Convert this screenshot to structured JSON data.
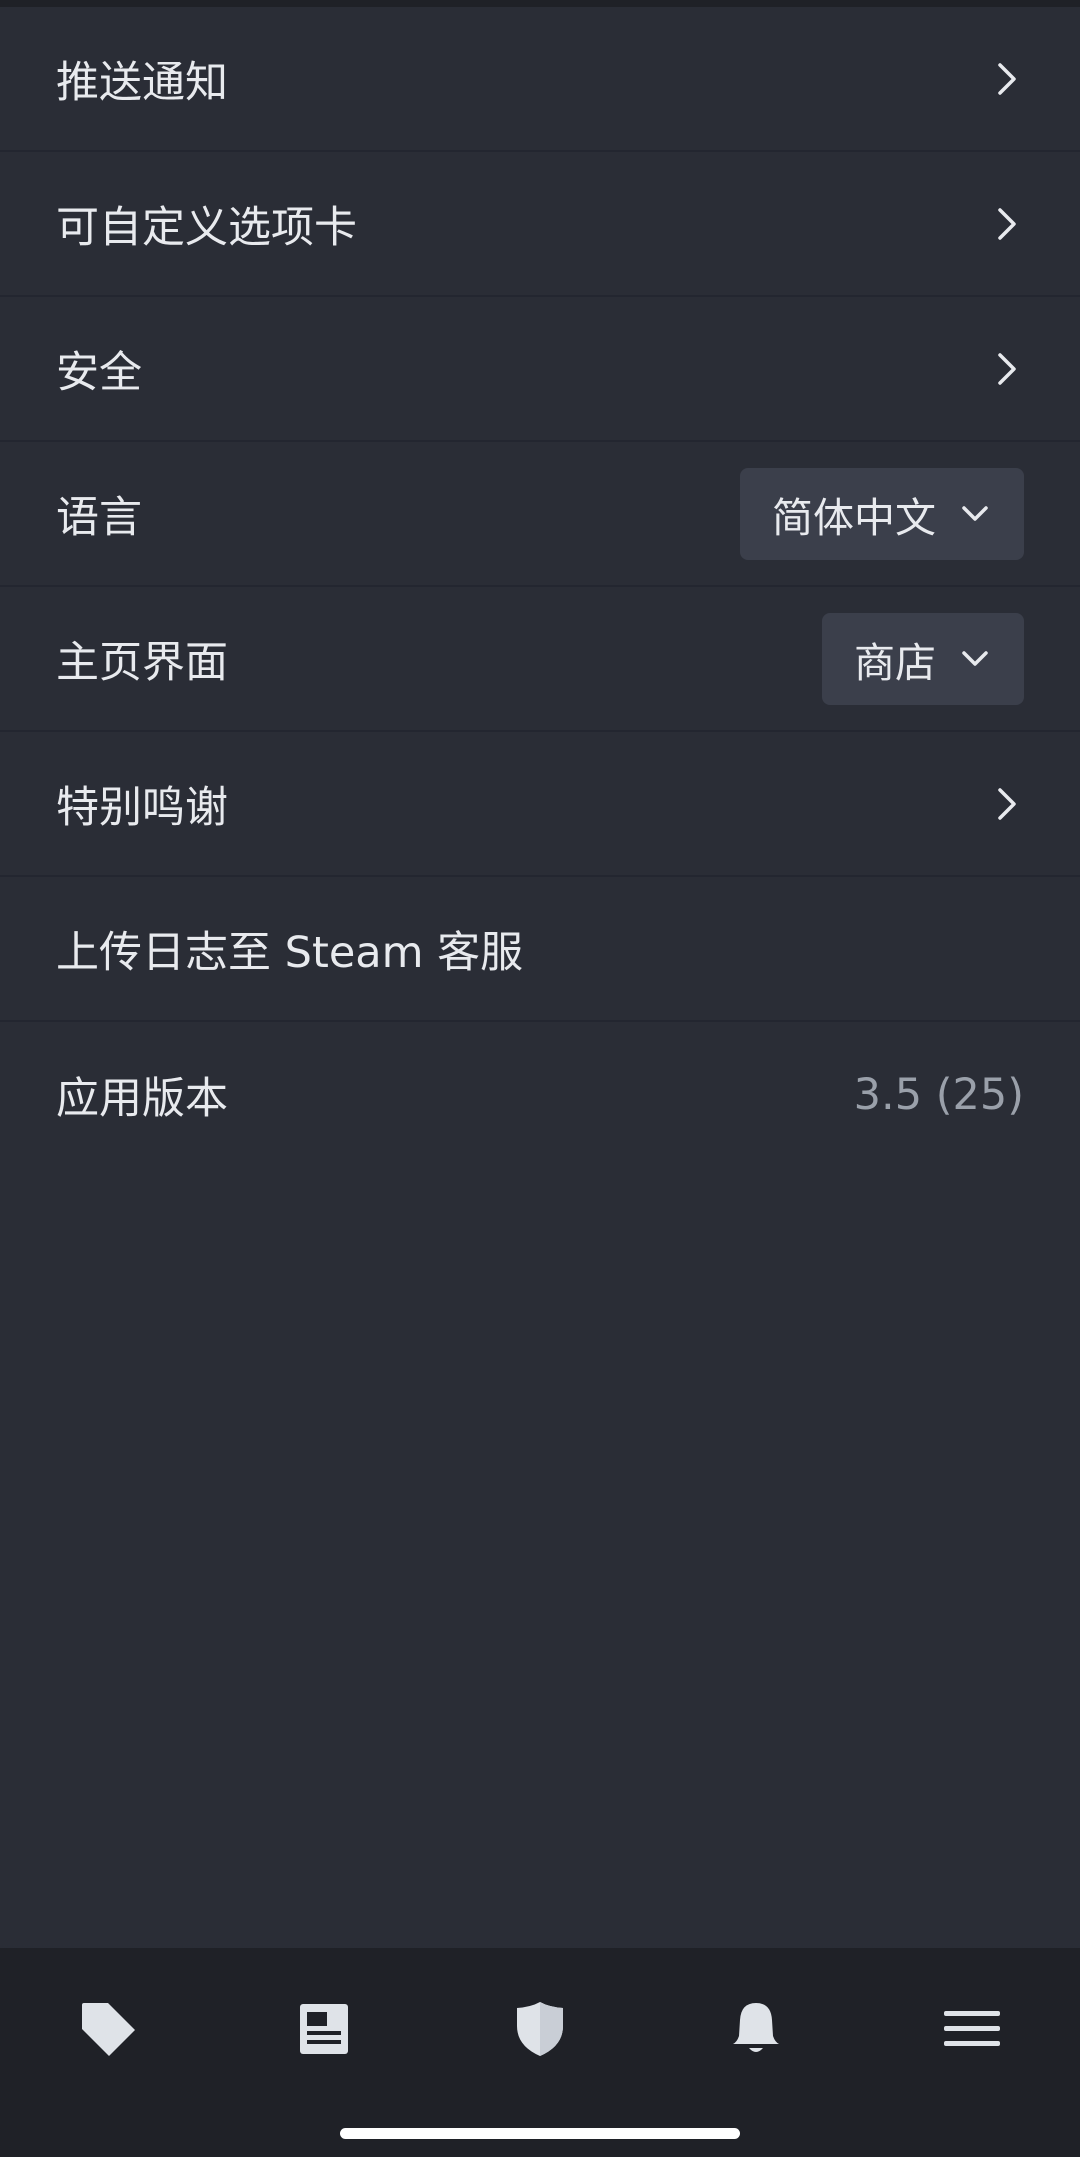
{
  "settings": {
    "push_notifications": "推送通知",
    "custom_tabs": "可自定义选项卡",
    "security": "安全",
    "language_label": "语言",
    "language_value": "简体中文",
    "home_label": "主页界面",
    "home_value": "商店",
    "special_thanks": "特别鸣谢",
    "upload_logs": "上传日志至 Steam 客服",
    "app_version_label": "应用版本",
    "app_version_value": "3.5 (25)"
  },
  "bottom_nav": {
    "icons": [
      "tag-icon",
      "news-icon",
      "shield-icon",
      "bell-icon",
      "menu-icon"
    ]
  },
  "colors": {
    "background": "#2a2d36",
    "nav_background": "#1f2127",
    "dropdown_background": "#3b3f4b",
    "text": "#e8eaee",
    "muted_text": "#9aa0aa",
    "icon": "#dfe3e8"
  }
}
